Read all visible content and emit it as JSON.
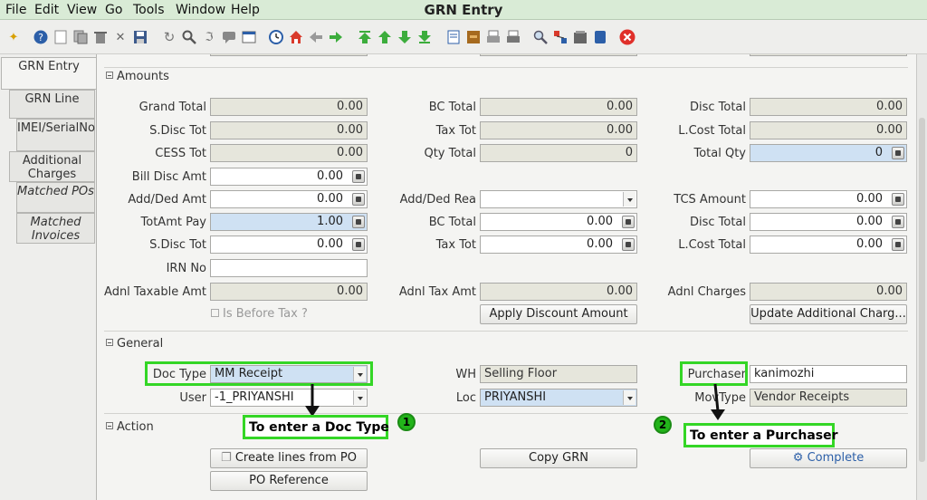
{
  "menubar": {
    "items": [
      "File",
      "Edit",
      "View",
      "Go",
      "Tools",
      "Window",
      "Help"
    ],
    "title": "GRN Entry"
  },
  "tabs": [
    {
      "label": "GRN Entry"
    },
    {
      "label": "GRN Line"
    },
    {
      "label": "IMEI/SerialNo"
    },
    {
      "label": "Additional Charges"
    },
    {
      "label": "Matched POs"
    },
    {
      "label": "Matched Invoices"
    }
  ],
  "amounts": {
    "section_label": "Amounts",
    "grand_total": {
      "label": "Grand Total",
      "value": "0.00"
    },
    "bc_total": {
      "label": "BC Total",
      "value": "0.00"
    },
    "disc_total": {
      "label": "Disc Total",
      "value": "0.00"
    },
    "s_disc_tot": {
      "label": "S.Disc Tot",
      "value": "0.00"
    },
    "tax_tot": {
      "label": "Tax Tot",
      "value": "0.00"
    },
    "l_cost_total": {
      "label": "L.Cost Total",
      "value": "0.00"
    },
    "cess_tot": {
      "label": "CESS Tot",
      "value": "0.00"
    },
    "qty_total": {
      "label": "Qty Total",
      "value": "0"
    },
    "total_qty": {
      "label": "Total Qty",
      "value": "0"
    },
    "bill_disc_amt": {
      "label": "Bill Disc Amt",
      "value": "0.00"
    },
    "add_ded_amt": {
      "label": "Add/Ded Amt",
      "value": "0.00"
    },
    "add_ded_rea": {
      "label": "Add/Ded Rea",
      "value": ""
    },
    "tcs_amount": {
      "label": "TCS Amount",
      "value": "0.00"
    },
    "totamt_pay": {
      "label": "TotAmt Pay",
      "value": "1.00"
    },
    "bc_total2": {
      "label": "BC Total",
      "value": "0.00"
    },
    "disc_total2": {
      "label": "Disc Total",
      "value": "0.00"
    },
    "s_disc_tot2": {
      "label": "S.Disc Tot",
      "value": "0.00"
    },
    "tax_tot2": {
      "label": "Tax Tot",
      "value": "0.00"
    },
    "l_cost_total2": {
      "label": "L.Cost Total",
      "value": "0.00"
    },
    "irn_no": {
      "label": "IRN No",
      "value": ""
    },
    "adnl_taxable_amt": {
      "label": "Adnl Taxable Amt",
      "value": "0.00"
    },
    "adnl_tax_amt": {
      "label": "Adnl Tax Amt",
      "value": "0.00"
    },
    "adnl_charges": {
      "label": "Adnl Charges",
      "value": "0.00"
    },
    "is_before_tax": "Is Before Tax ?",
    "apply_discount_btn": "Apply Discount Amount",
    "update_charges_btn": "Update Additional Charg..."
  },
  "general": {
    "section_label": "General",
    "doc_type": {
      "label": "Doc Type",
      "value": "MM Receipt"
    },
    "wh": {
      "label": "WH",
      "value": "Selling Floor"
    },
    "purchaser": {
      "label": "Purchaser",
      "value": "kanimozhi"
    },
    "user": {
      "label": "User",
      "value": "-1_PRIYANSHI"
    },
    "loc": {
      "label": "Loc",
      "value": "PRIYANSHI"
    },
    "mov_type": {
      "label": "MovType",
      "value": "Vendor Receipts"
    }
  },
  "action": {
    "section_label": "Action",
    "create_lines_btn": "Create lines from PO",
    "copy_grn_btn": "Copy GRN",
    "complete_btn": "Complete",
    "po_reference_btn": "PO Reference"
  },
  "annotations": {
    "callout1": "To enter a Doc Type",
    "callout2": "To enter a Purchaser",
    "badge1": "1",
    "badge2": "2"
  },
  "colors": {
    "highlight": "#34d626",
    "menubar_bg": "#d9ebd6",
    "readonly_field": "#e6e6dc",
    "selected_field": "#cfe1f3"
  }
}
